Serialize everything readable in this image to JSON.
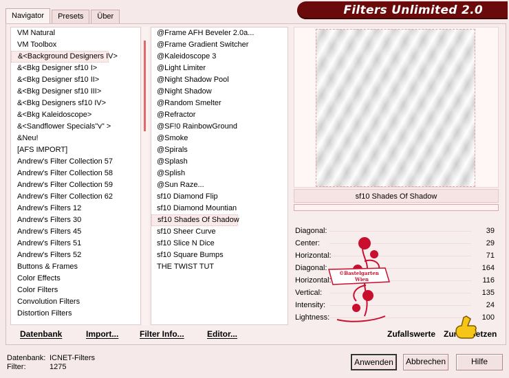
{
  "tabs": [
    "Navigator",
    "Presets",
    "Über"
  ],
  "app_title": "Filters Unlimited 2.0",
  "categories": [
    "VM Natural",
    "VM Toolbox",
    "&<Background Designers IV>",
    "&<Bkg Designer sf10 I>",
    "&<Bkg Designer sf10 II>",
    "&<Bkg Designer sf10 III>",
    "&<Bkg Designers sf10 IV>",
    "&<Bkg Kaleidoscope>",
    "&<Sandflower Specials\"v\" >",
    "&Neu!",
    "[AFS IMPORT]",
    "Andrew's Filter Collection 57",
    "Andrew's Filter Collection 58",
    "Andrew's Filter Collection 59",
    "Andrew's Filter Collection 62",
    "Andrew's Filters 12",
    "Andrew's Filters 30",
    "Andrew's Filters 45",
    "Andrew's Filters 51",
    "Andrew's Filters 52",
    "Buttons & Frames",
    "Color Effects",
    "Color Filters",
    "Convolution Filters",
    "Distortion Filters"
  ],
  "filters": [
    "@Frame AFH Beveler 2.0a...",
    "@Frame Gradient Switcher",
    "@Kaleidoscope 3",
    "@Light Limiter",
    "@Night Shadow Pool",
    "@Night Shadow",
    "@Random Smelter",
    "@Refractor",
    "@SF!0 RainbowGround",
    "@Smoke",
    "@Spirals",
    "@Splash",
    "@Splish",
    "@Sun Raze...",
    "sf10 Diamond Flip",
    "sf10 Diamond Mountian",
    "sf10 Shades Of Shadow",
    "sf10 Sheer Curve",
    "sf10 Slice N Dice",
    "sf10 Square Bumps",
    "THE TWIST TUT"
  ],
  "selected_filter": "sf10 Shades Of Shadow",
  "params": [
    {
      "label": "Diagonal:",
      "value": "39"
    },
    {
      "label": "Center:",
      "value": "29"
    },
    {
      "label": "Horizontal:",
      "value": "71"
    },
    {
      "label": "Diagonal:",
      "value": "164"
    },
    {
      "label": "Horizontal:",
      "value": "116"
    },
    {
      "label": "Vertical:",
      "value": "135"
    },
    {
      "label": "Intensity:",
      "value": "24"
    },
    {
      "label": "Lightness:",
      "value": "100"
    }
  ],
  "buttons": {
    "datenbank": "Datenbank",
    "import": "Import...",
    "filter_info": "Filter Info...",
    "editor": "Editor...",
    "zufallswerte": "Zufallswerte",
    "zuruecksetzen": "Zurücksetzen",
    "anwenden": "Anwenden",
    "abbrechen": "Abbrechen",
    "hilfe": "Hilfe"
  },
  "status": {
    "db_label": "Datenbank:",
    "db_value": "ICNET-Filters",
    "filter_label": "Filter:",
    "filter_value": "1275"
  },
  "watermark": "©Bastelgarten Wien",
  "colors": {
    "banner": "#6a0a0a",
    "accent": "#e06a6a",
    "stamp": "#c8102e"
  }
}
